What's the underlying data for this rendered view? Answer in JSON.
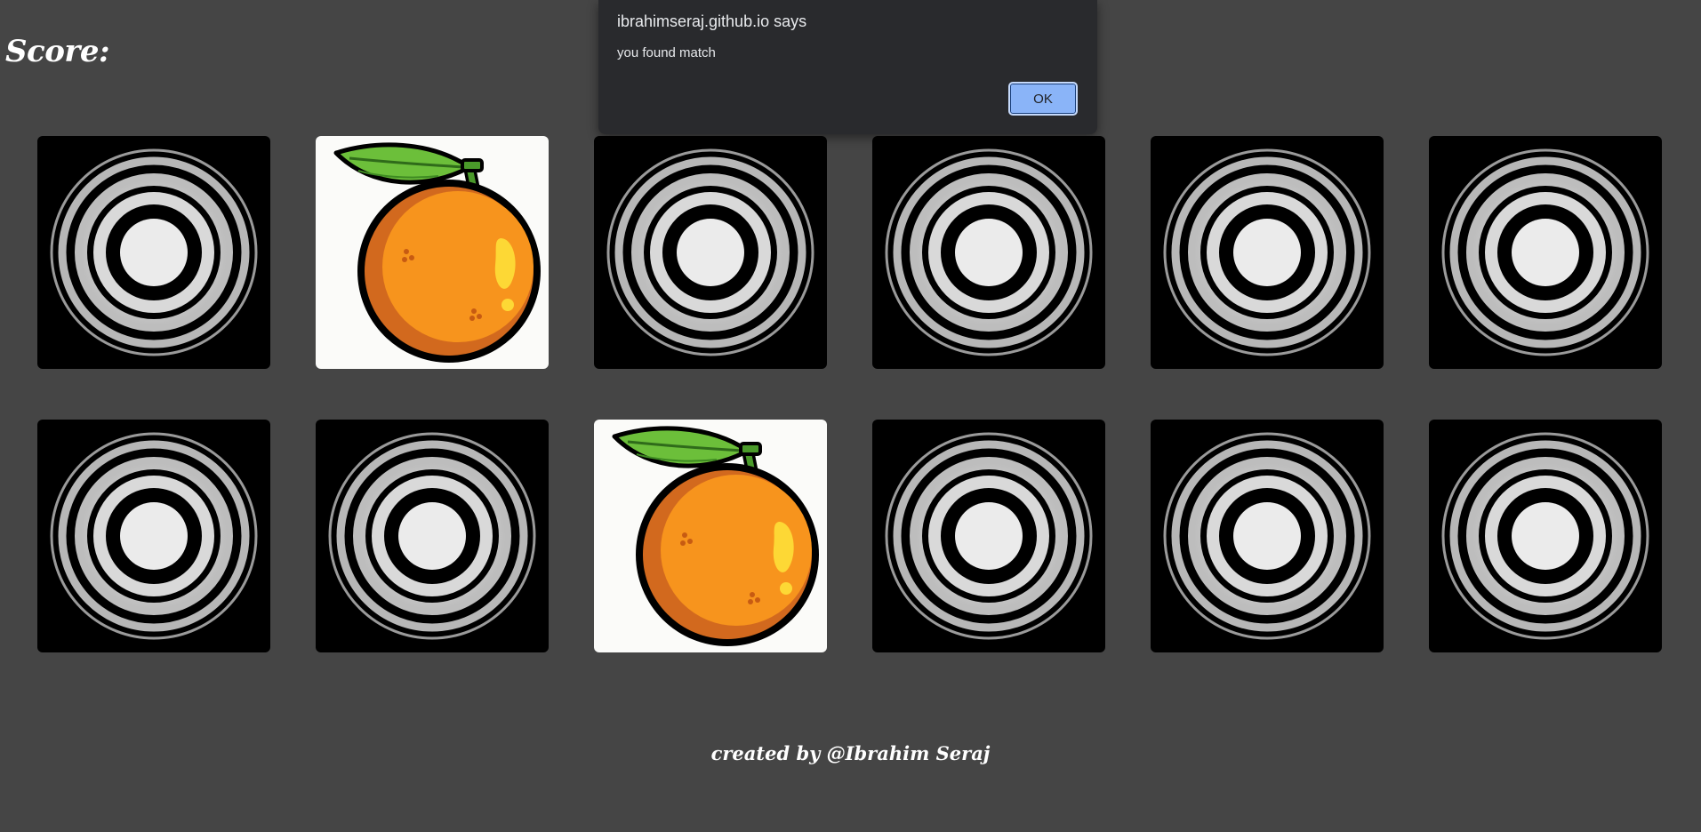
{
  "header": {
    "score_label": "Score:"
  },
  "board": {
    "rows": [
      [
        {
          "state": "face-down",
          "icon": "concentric-rings-icon"
        },
        {
          "state": "face-up",
          "icon": "orange-fruit-icon"
        },
        {
          "state": "face-down",
          "icon": "concentric-rings-icon"
        },
        {
          "state": "face-down",
          "icon": "concentric-rings-icon"
        },
        {
          "state": "face-down",
          "icon": "concentric-rings-icon"
        },
        {
          "state": "face-down",
          "icon": "concentric-rings-icon"
        }
      ],
      [
        {
          "state": "face-down",
          "icon": "concentric-rings-icon"
        },
        {
          "state": "face-down",
          "icon": "concentric-rings-icon"
        },
        {
          "state": "face-up",
          "icon": "orange-fruit-icon"
        },
        {
          "state": "face-down",
          "icon": "concentric-rings-icon"
        },
        {
          "state": "face-down",
          "icon": "concentric-rings-icon"
        },
        {
          "state": "face-down",
          "icon": "concentric-rings-icon"
        }
      ]
    ]
  },
  "footer": {
    "credit": "created by @Ibrahim Seraj"
  },
  "dialog": {
    "title": "ibrahimseraj.github.io says",
    "message": "you found match",
    "ok_label": "OK"
  },
  "colors": {
    "page_background": "#454545",
    "card_back": "#000000",
    "card_face": "#fbfbf9",
    "dialog_background": "#292a2d",
    "ok_button": "#8ab4f8",
    "orange": "#f7941d",
    "leaf": "#6cbf3a"
  }
}
